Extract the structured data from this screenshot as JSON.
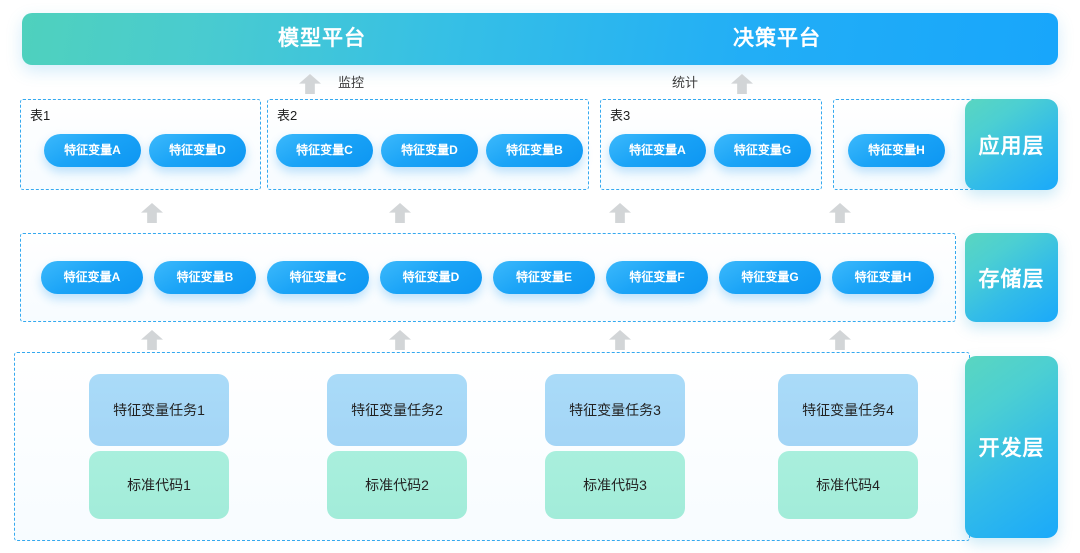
{
  "header": {
    "platforms": [
      {
        "label": "模型平台"
      },
      {
        "label": "决策平台"
      }
    ]
  },
  "flows": [
    {
      "label": "监控",
      "arrow_icon": "up-arrow-icon",
      "arrow_side": "left"
    },
    {
      "label": "统计",
      "arrow_icon": "up-arrow-icon",
      "arrow_side": "right"
    }
  ],
  "layers": [
    {
      "id": "application",
      "badge": "应用层",
      "groups": [
        {
          "label": "表1",
          "items": [
            {
              "label": "特征变量A"
            },
            {
              "label": "特征变量D"
            }
          ]
        },
        {
          "label": "表2",
          "items": [
            {
              "label": "特征变量C"
            },
            {
              "label": "特征变量D"
            },
            {
              "label": "特征变量B"
            }
          ]
        },
        {
          "label": "表3",
          "items": [
            {
              "label": "特征变量A"
            },
            {
              "label": "特征变量G"
            }
          ]
        },
        {
          "label": "",
          "items": [
            {
              "label": "特征变量H"
            }
          ]
        }
      ]
    },
    {
      "id": "storage",
      "badge": "存储层",
      "groups": [
        {
          "label": "",
          "items": [
            {
              "label": "特征变量A"
            },
            {
              "label": "特征变量B"
            },
            {
              "label": "特征变量C"
            },
            {
              "label": "特征变量D"
            },
            {
              "label": "特征变量E"
            },
            {
              "label": "特征变量F"
            },
            {
              "label": "特征变量G"
            },
            {
              "label": "特征变量H"
            }
          ]
        }
      ]
    },
    {
      "id": "development",
      "badge": "开发层",
      "columns": [
        {
          "task": "特征变量任务1",
          "code": "标准代码1"
        },
        {
          "task": "特征变量任务2",
          "code": "标准代码2"
        },
        {
          "task": "特征变量任务3",
          "code": "标准代码3"
        },
        {
          "task": "特征变量任务4",
          "code": "标准代码4"
        }
      ]
    }
  ],
  "connectors": {
    "icon": "up-arrow-icon",
    "between_app_and_storage_count": 4,
    "between_storage_and_dev_count": 4
  },
  "colors": {
    "accent_teal": "#4fd1bd",
    "accent_blue": "#18a6fb",
    "pill_blue": "#1ba4f7",
    "dashed_border": "#35a9ef",
    "task_card": "#a8d8f7",
    "code_card": "#a6eddb",
    "arrow_gray": "#d2d5d7"
  }
}
